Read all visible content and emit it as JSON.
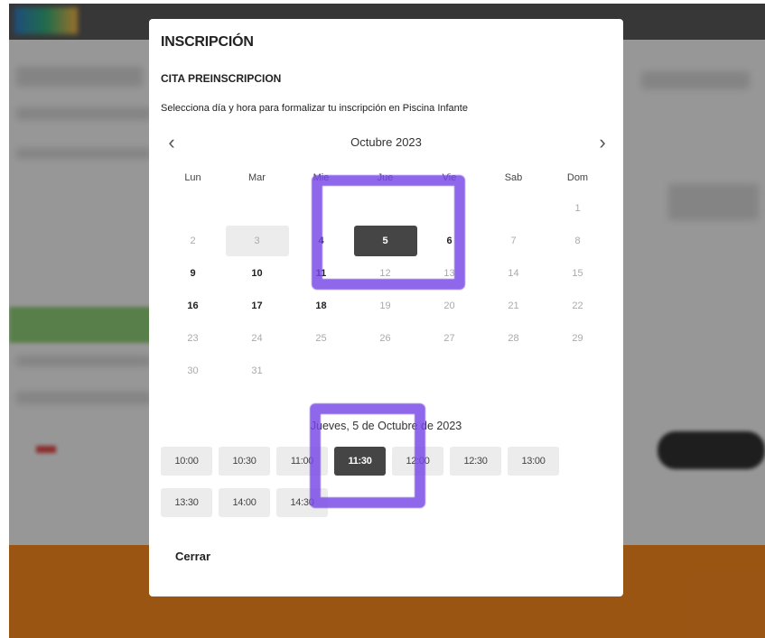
{
  "modal": {
    "title": "INSCRIPCIÓN",
    "subtitle": "CITA PREINSCRIPCION",
    "description": "Selecciona día y hora para formalizar tu inscripción en Piscina Infante",
    "close_label": "Cerrar"
  },
  "calendar": {
    "month_label": "Octubre 2023",
    "prev_icon": "‹",
    "next_icon": "›",
    "weekdays": [
      "Lun",
      "Mar",
      "Mie",
      "Jue",
      "Vie",
      "Sab",
      "Dom"
    ],
    "weeks": [
      [
        null,
        null,
        null,
        null,
        null,
        null,
        {
          "d": "1",
          "s": "disabled"
        }
      ],
      [
        {
          "d": "2",
          "s": "disabled"
        },
        {
          "d": "3",
          "s": "today"
        },
        {
          "d": "4",
          "s": "available"
        },
        {
          "d": "5",
          "s": "selected"
        },
        {
          "d": "6",
          "s": "available"
        },
        {
          "d": "7",
          "s": "disabled"
        },
        {
          "d": "8",
          "s": "disabled"
        }
      ],
      [
        {
          "d": "9",
          "s": "available"
        },
        {
          "d": "10",
          "s": "available"
        },
        {
          "d": "11",
          "s": "available"
        },
        {
          "d": "12",
          "s": "disabled"
        },
        {
          "d": "13",
          "s": "disabled"
        },
        {
          "d": "14",
          "s": "disabled"
        },
        {
          "d": "15",
          "s": "disabled"
        }
      ],
      [
        {
          "d": "16",
          "s": "available"
        },
        {
          "d": "17",
          "s": "available"
        },
        {
          "d": "18",
          "s": "available"
        },
        {
          "d": "19",
          "s": "disabled"
        },
        {
          "d": "20",
          "s": "disabled"
        },
        {
          "d": "21",
          "s": "disabled"
        },
        {
          "d": "22",
          "s": "disabled"
        }
      ],
      [
        {
          "d": "23",
          "s": "disabled"
        },
        {
          "d": "24",
          "s": "disabled"
        },
        {
          "d": "25",
          "s": "disabled"
        },
        {
          "d": "26",
          "s": "disabled"
        },
        {
          "d": "27",
          "s": "disabled"
        },
        {
          "d": "28",
          "s": "disabled"
        },
        {
          "d": "29",
          "s": "disabled"
        }
      ],
      [
        {
          "d": "30",
          "s": "disabled"
        },
        {
          "d": "31",
          "s": "disabled"
        },
        null,
        null,
        null,
        null,
        null
      ]
    ]
  },
  "selected_date_label": "Jueves, 5 de Octubre de 2023",
  "time_slots": [
    {
      "t": "10:00",
      "selected": false
    },
    {
      "t": "10:30",
      "selected": false
    },
    {
      "t": "11:00",
      "selected": false
    },
    {
      "t": "11:30",
      "selected": true
    },
    {
      "t": "12:00",
      "selected": false
    },
    {
      "t": "12:30",
      "selected": false
    },
    {
      "t": "13:00",
      "selected": false
    },
    {
      "t": "13:30",
      "selected": false
    },
    {
      "t": "14:00",
      "selected": false
    },
    {
      "t": "14:30",
      "selected": false
    }
  ],
  "colors": {
    "selected_bg": "#454545",
    "highlight_mark": "#7646e6",
    "footer_orange": "#dd7a1c"
  }
}
